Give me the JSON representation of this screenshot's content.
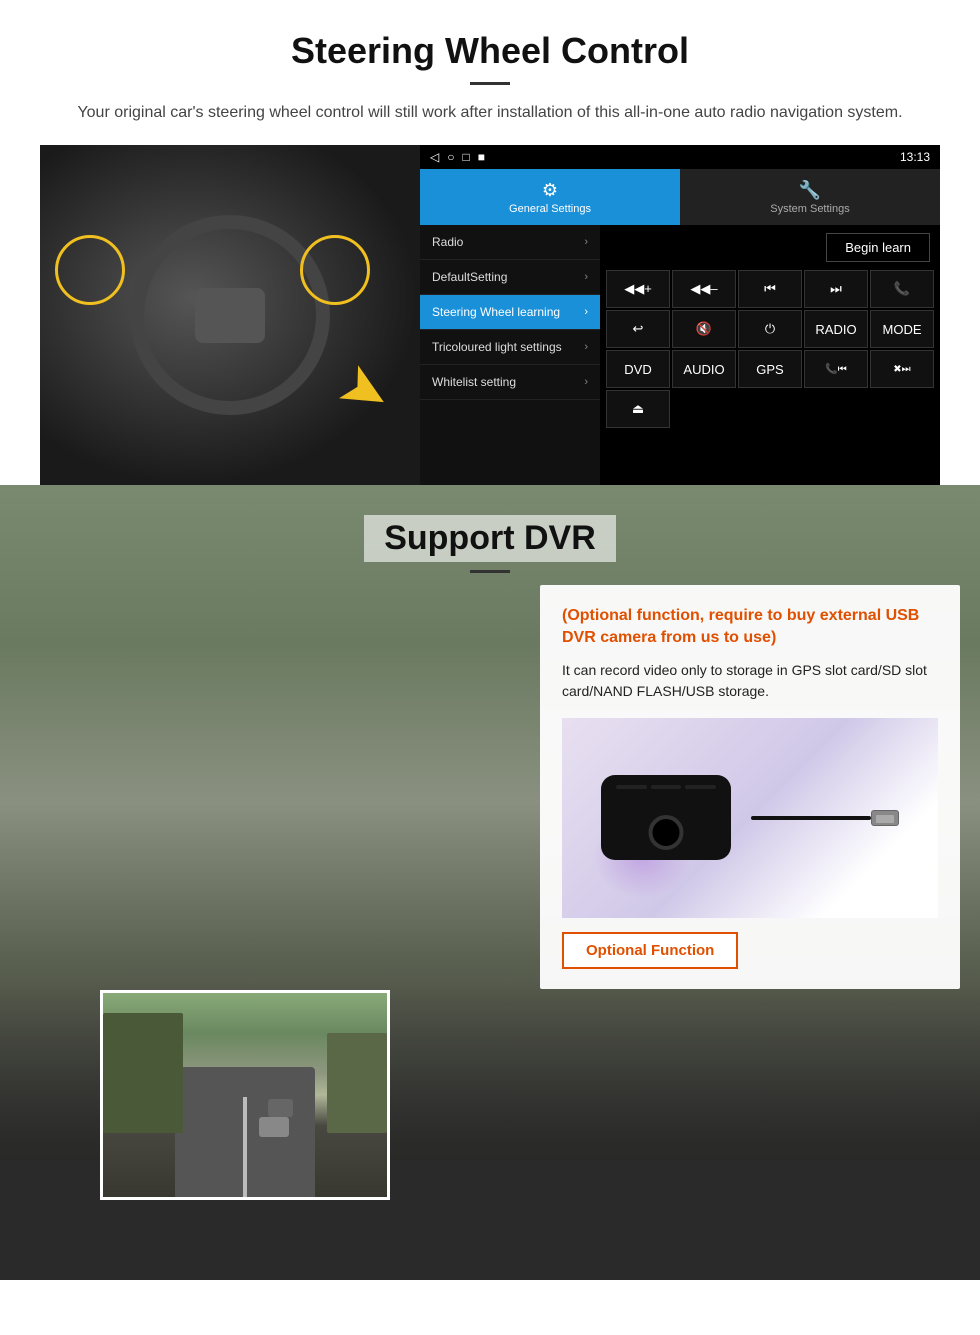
{
  "steering": {
    "title": "Steering Wheel Control",
    "subtitle": "Your original car's steering wheel control will still work after installation of this all-in-one auto radio navigation system.",
    "statusbar": {
      "icons_left": [
        "◁",
        "○",
        "□",
        "■"
      ],
      "time": "13:13",
      "signal": "▼"
    },
    "tabs": {
      "general_settings": "General Settings",
      "system_settings": "System Settings"
    },
    "menu_items": [
      {
        "label": "Radio",
        "active": false
      },
      {
        "label": "DefaultSetting",
        "active": false
      },
      {
        "label": "Steering Wheel learning",
        "active": true
      },
      {
        "label": "Tricoloured light settings",
        "active": false
      },
      {
        "label": "Whitelist setting",
        "active": false
      }
    ],
    "begin_learn": "Begin learn",
    "button_grid_row1": [
      "◀◀+",
      "◀◀–",
      "◀◀",
      "▶▶",
      "📞"
    ],
    "button_grid_row2": [
      "↩",
      "🔇",
      "⏻",
      "RADIO",
      "MODE"
    ],
    "button_grid_row3": [
      "DVD",
      "AUDIO",
      "GPS",
      "📞◀◀",
      "✖▶▶"
    ],
    "button_grid_row4": [
      "⏏"
    ]
  },
  "dvr": {
    "title": "Support DVR",
    "optional_text": "(Optional function, require to buy external USB DVR camera from us to use)",
    "description": "It can record video only to storage in GPS slot card/SD slot card/NAND FLASH/USB storage.",
    "optional_button": "Optional Function"
  }
}
